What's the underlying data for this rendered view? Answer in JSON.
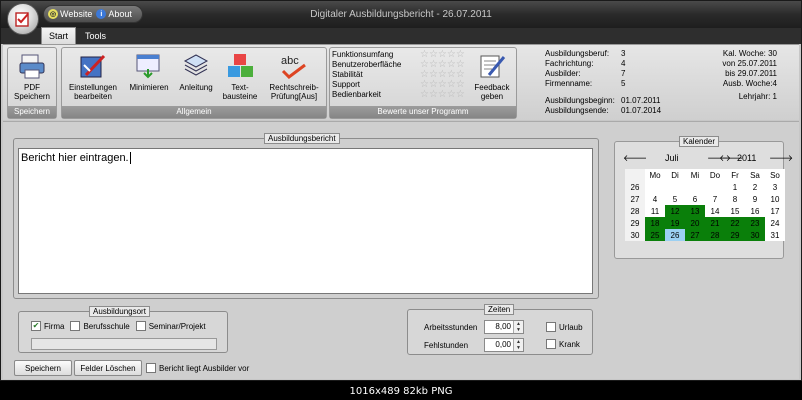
{
  "window": {
    "title": "Digitaler Ausbildungsbericht - 26.07.2011"
  },
  "quickaccess": {
    "website": "Website",
    "about": "About"
  },
  "tabs": [
    {
      "label": "Start"
    },
    {
      "label": "Tools"
    }
  ],
  "ribbon": {
    "speichern_group": "Speichern",
    "pdf_label": "PDF\nSpeichern",
    "allgemein_group": "Allgemein",
    "einstellungen_label": "Einstellungen\nbearbeiten",
    "minimieren_label": "Minimieren",
    "anleitung_label": "Anleitung",
    "textbausteine_label": "Text-\nbausteine",
    "rechtschreib_label": "Rechtschreib-\nPrüfung[Aus]",
    "bewerte_group": "Bewerte unser Programm",
    "ratings": [
      {
        "label": "Funktionsumfang",
        "stars": 0
      },
      {
        "label": "Benutzeroberfläche",
        "stars": 0
      },
      {
        "label": "Stabilität",
        "stars": 0
      },
      {
        "label": "Support",
        "stars": 0
      },
      {
        "label": "Bedienbarkeit",
        "stars": 0
      }
    ],
    "feedback_label": "Feedback\ngeben",
    "info": {
      "beruf_label": "Ausbildungsberuf:",
      "beruf_value": "3",
      "fach_label": "Fachrichtung:",
      "fach_value": "4",
      "ausbilder_label": "Ausbilder:",
      "ausbilder_value": "7",
      "firma_label": "Firmenname:",
      "firma_value": "5",
      "beginn_label": "Ausbildungsbeginn:",
      "beginn_value": "01.07.2011",
      "ende_label": "Ausbildungsende:",
      "ende_value": "01.07.2014",
      "kw_label": "Kal. Woche:",
      "kw_value": "30",
      "von_label": "von",
      "von_value": "25.07.2011",
      "bis_label": "bis",
      "bis_value": "29.07.2011",
      "ausbwoche_label": "Ausb. Woche:",
      "ausbwoche_value": "4",
      "lehrjahr_label": "Lehrjahr:",
      "lehrjahr_value": "1"
    }
  },
  "report": {
    "legend": "Ausbildungsbericht",
    "text": "Bericht hier eintragen."
  },
  "calendar": {
    "legend": "Kalender",
    "month": "Juli",
    "year": "2011",
    "headers": [
      "Mo",
      "Di",
      "Mi",
      "Do",
      "Fr",
      "Sa",
      "So"
    ],
    "weeks": [
      {
        "kw": "26",
        "days": [
          "",
          "",
          "",
          "",
          "1",
          "2",
          "3"
        ]
      },
      {
        "kw": "27",
        "days": [
          "4",
          "5",
          "6",
          "7",
          "8",
          "9",
          "10"
        ]
      },
      {
        "kw": "28",
        "days": [
          "11",
          "12",
          "13",
          "14",
          "15",
          "16",
          "17"
        ]
      },
      {
        "kw": "29",
        "days": [
          "18",
          "19",
          "20",
          "21",
          "22",
          "23",
          "24"
        ]
      },
      {
        "kw": "30",
        "days": [
          "25",
          "26",
          "27",
          "28",
          "29",
          "30",
          "31"
        ]
      }
    ]
  },
  "ausbildungsort": {
    "legend": "Ausbildungsort",
    "firma": "Firma",
    "firma_checked": true,
    "berufsschule": "Berufsschule",
    "berufsschule_checked": false,
    "seminar": "Seminar/Projekt",
    "seminar_checked": false,
    "field_value": ""
  },
  "zeiten": {
    "legend": "Zeiten",
    "arbeitsstunden_label": "Arbeitsstunden",
    "arbeitsstunden_value": "8,00",
    "fehlstunden_label": "Fehlstunden",
    "fehlstunden_value": "0,00",
    "urlaub": "Urlaub",
    "krank": "Krank"
  },
  "actions": {
    "speichern": "Speichern",
    "felder_loeschen": "Felder Löschen",
    "ausbilder_label": "Bericht liegt Ausbilder vor"
  },
  "status_bar": "1016x489 82kb PNG",
  "colors": {
    "green": "#0a7f0a",
    "today": "#9cd0f2"
  }
}
